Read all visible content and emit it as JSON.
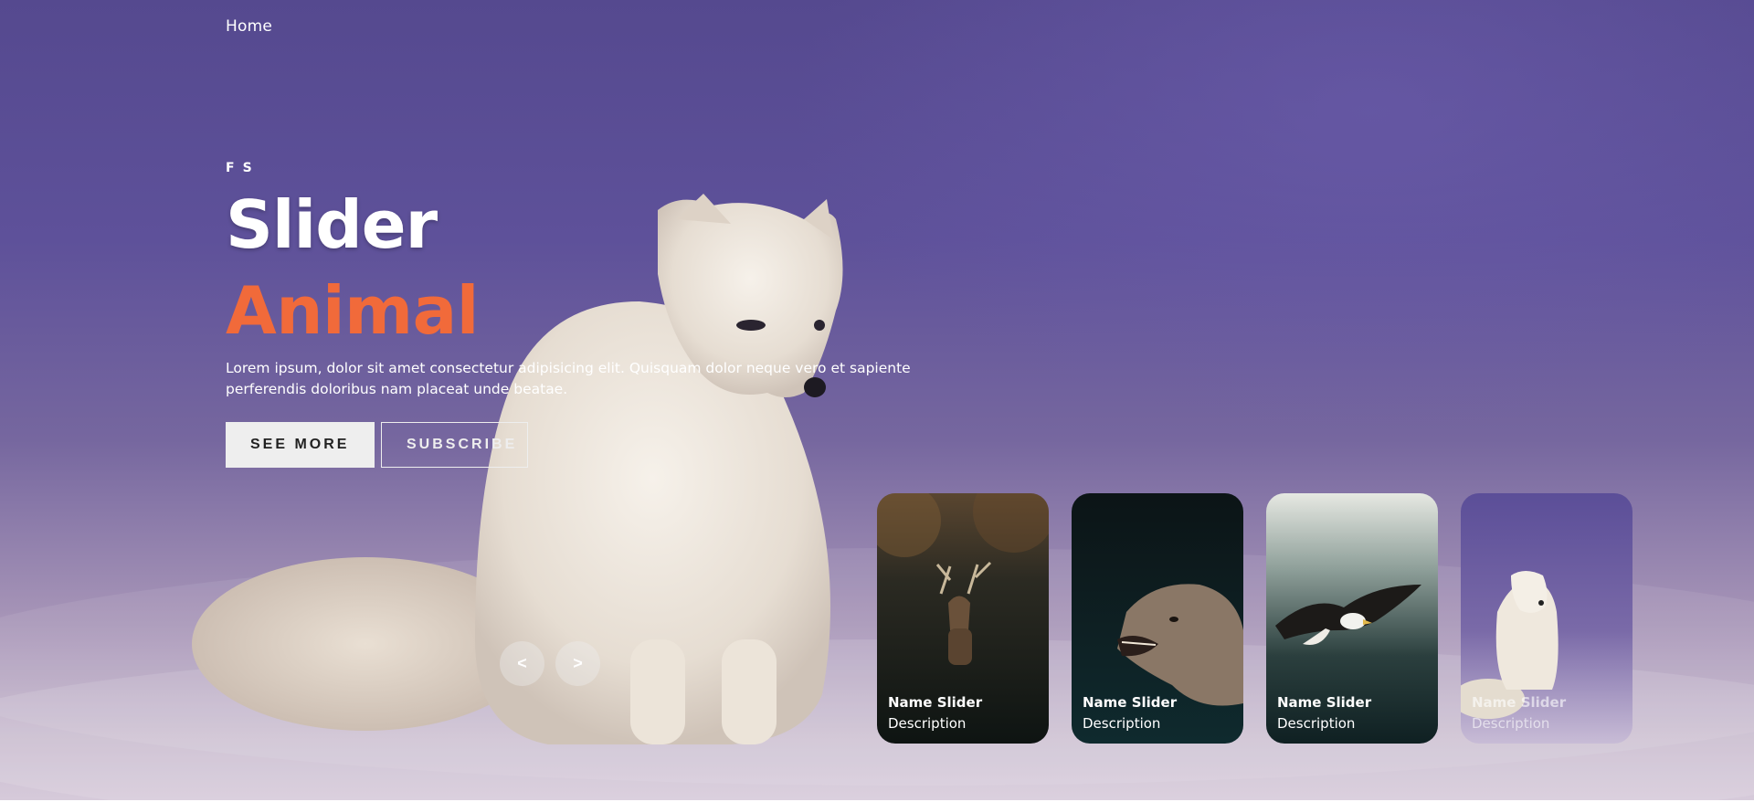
{
  "nav": {
    "home": "Home"
  },
  "slide": {
    "author": "FS",
    "title": "Slider",
    "topic": "Animal",
    "description": "Lorem ipsum, dolor sit amet consectetur adipisicing elit. Quisquam dolor neque vero et sapiente perferendis doloribus nam placeat unde beatae.",
    "see_more": "SEE MORE",
    "subscribe": "SUBSCRIBE"
  },
  "controls": {
    "prev": "<",
    "next": ">"
  },
  "thumbnails": [
    {
      "name": "Name Slider",
      "description": "Description",
      "subject": "deer"
    },
    {
      "name": "Name Slider",
      "description": "Description",
      "subject": "wolf"
    },
    {
      "name": "Name Slider",
      "description": "Description",
      "subject": "eagle"
    },
    {
      "name": "Name Slider",
      "description": "Description",
      "subject": "arctic-fox"
    }
  ],
  "colors": {
    "accent": "#f16a3a",
    "background": "#5a4d96",
    "button_light": "#eeeeee"
  }
}
